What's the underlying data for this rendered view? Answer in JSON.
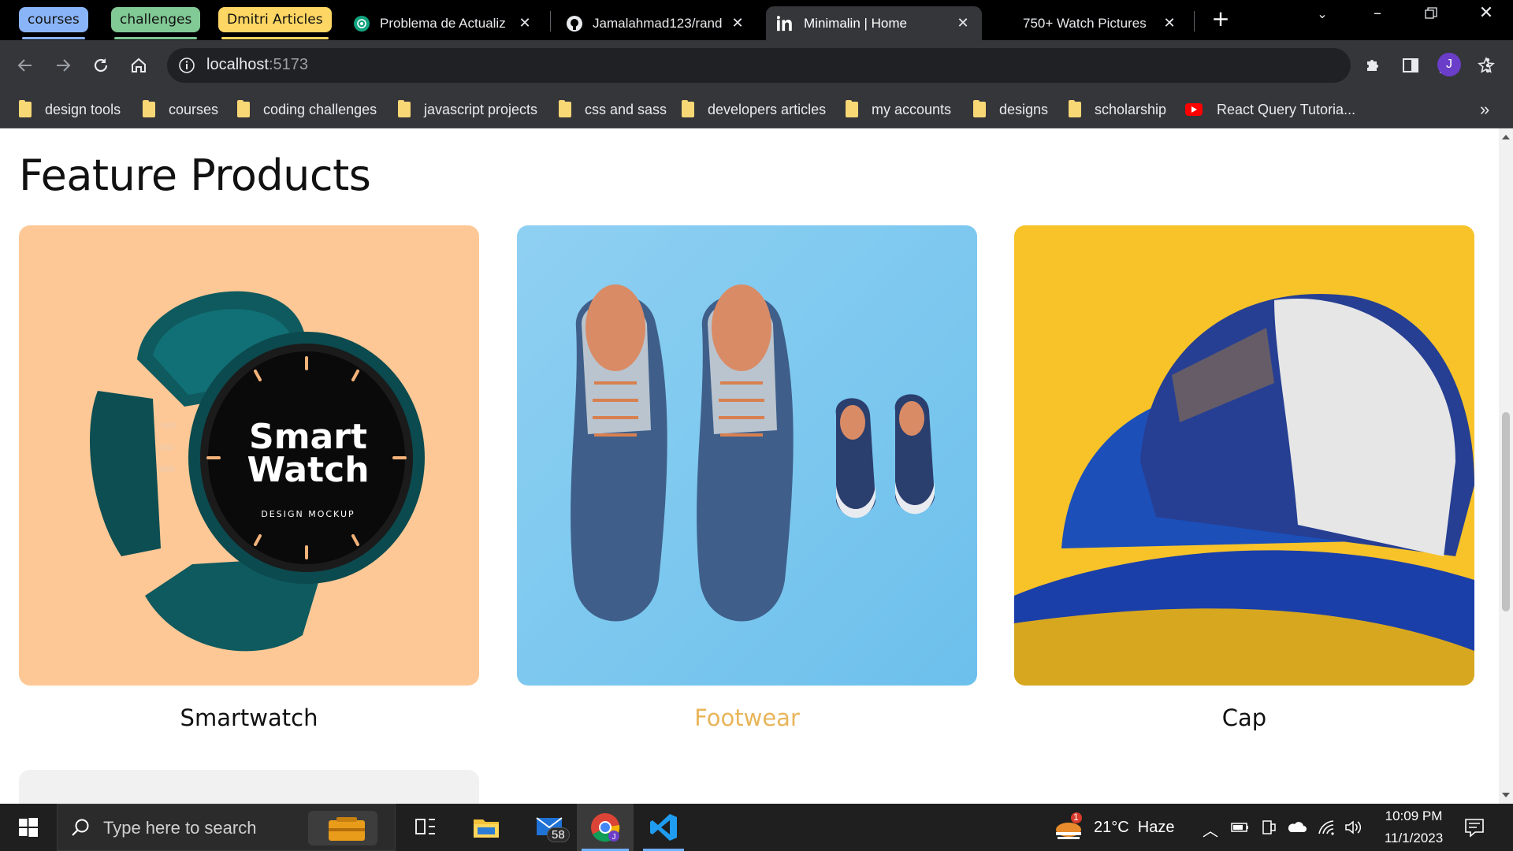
{
  "browser": {
    "tab_groups": [
      {
        "label": "courses",
        "color": "#8ab4f8"
      },
      {
        "label": "challenges",
        "color": "#81c995"
      },
      {
        "label": "Dmitri Articles",
        "color": "#fdd663"
      }
    ],
    "tabs": [
      {
        "title": "Problema de Actualiz",
        "icon": "chatgpt-icon"
      },
      {
        "title": "Jamalahmad123/rand",
        "icon": "github-icon"
      },
      {
        "title": "Minimalin | Home",
        "icon": "linkedin-icon",
        "active": true
      },
      {
        "title": "750+ Watch Pictures",
        "icon": "blank-icon"
      }
    ],
    "new_tab": "+",
    "url_host": "localhost",
    "url_port": ":5173",
    "profile_initial": "J",
    "bookmarks": [
      {
        "label": "design tools",
        "icon": "folder-icon"
      },
      {
        "label": "courses",
        "icon": "folder-icon"
      },
      {
        "label": "coding challenges",
        "icon": "folder-icon"
      },
      {
        "label": "javascript projects",
        "icon": "folder-icon"
      },
      {
        "label": "css and sass",
        "icon": "folder-icon"
      },
      {
        "label": "developers articles",
        "icon": "folder-icon"
      },
      {
        "label": "my accounts",
        "icon": "folder-icon"
      },
      {
        "label": "designs",
        "icon": "folder-icon"
      },
      {
        "label": "scholarship",
        "icon": "folder-icon"
      },
      {
        "label": "React Query Tutoria...",
        "icon": "youtube-icon"
      }
    ],
    "bookmarks_overflow": "»"
  },
  "page": {
    "title": "Feature Products",
    "products": [
      {
        "label": "Smartwatch",
        "bg": "#fec896",
        "watch_line1": "Smart",
        "watch_line2": "Watch",
        "watch_sub": "DESIGN MOCKUP"
      },
      {
        "label": "Footwear",
        "bg": "#79c8f0",
        "hovered": true,
        "label_color": "#e8b55a"
      },
      {
        "label": "Cap",
        "bg": "#f7c329"
      }
    ]
  },
  "taskbar": {
    "search_placeholder": "Type here to search",
    "mail_badge": "58",
    "weather_badge": "1",
    "weather": "21°C  Haze",
    "time": "10:09 PM",
    "date": "11/1/2023"
  }
}
